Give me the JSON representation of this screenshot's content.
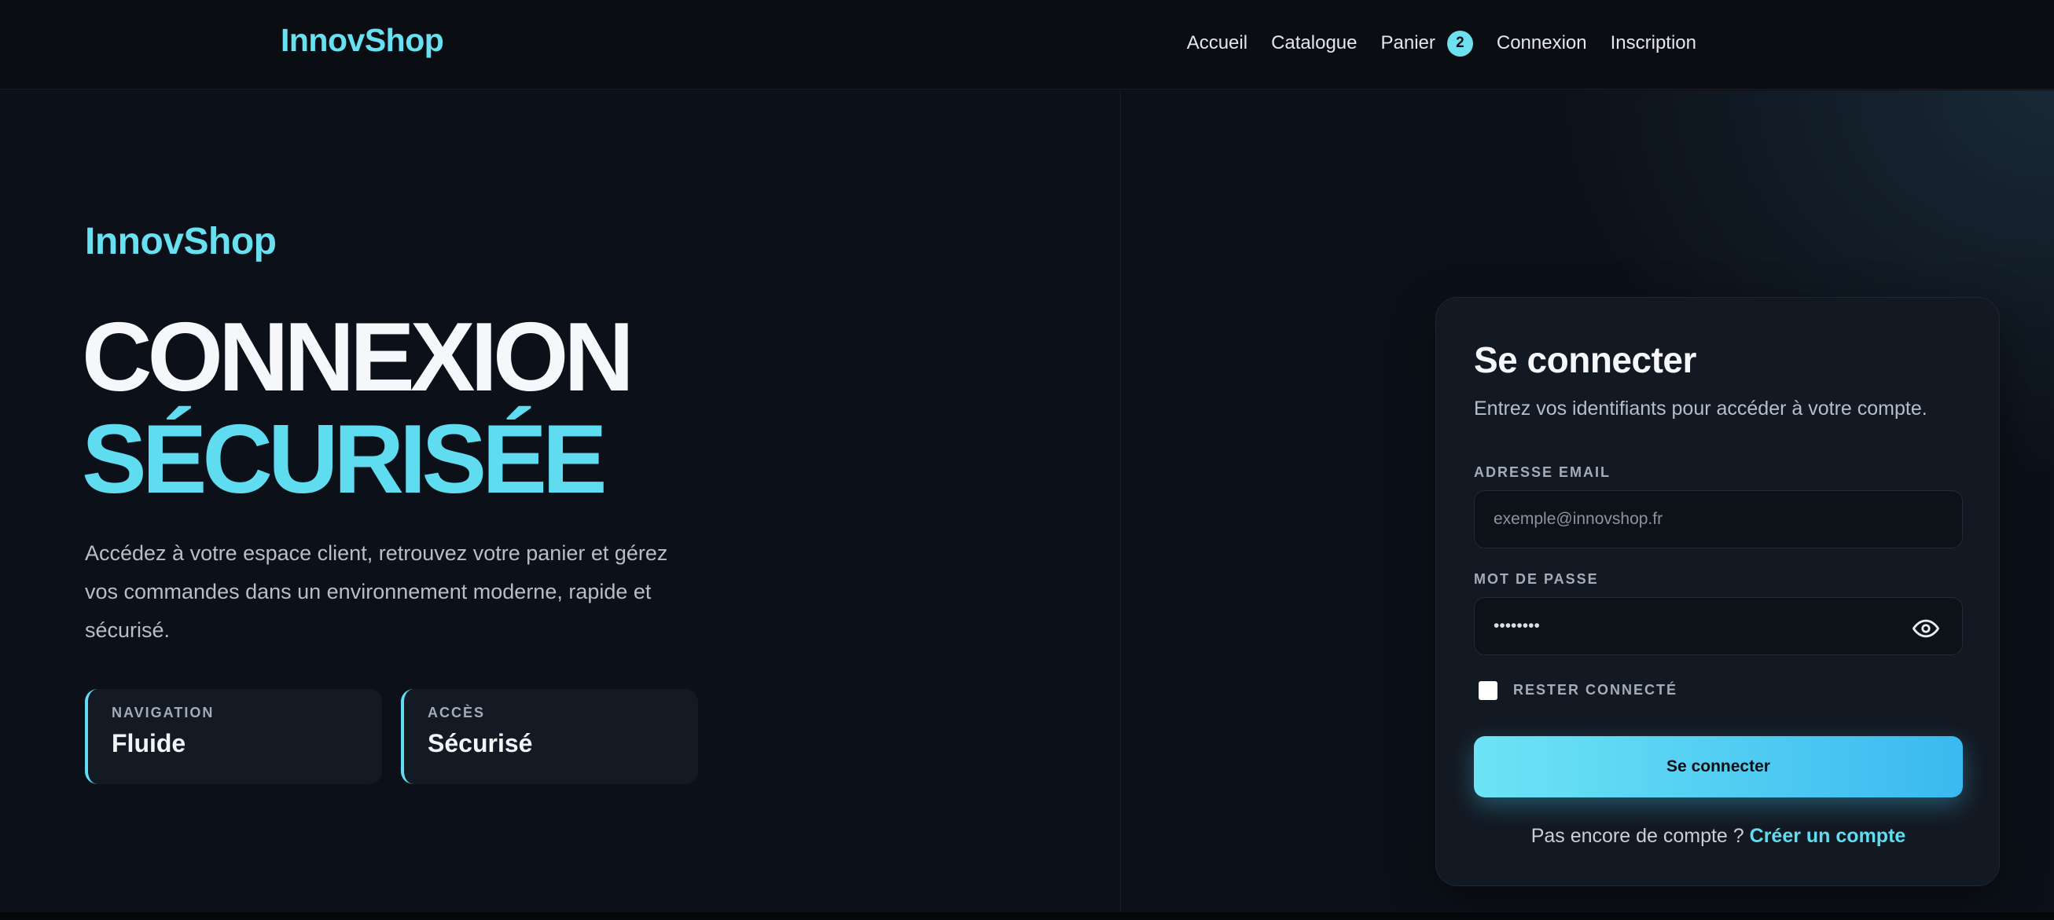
{
  "header": {
    "brand": "InnovShop",
    "nav": {
      "home": "Accueil",
      "catalog": "Catalogue",
      "cart": "Panier",
      "cart_count": "2",
      "login": "Connexion",
      "register": "Inscription"
    }
  },
  "hero": {
    "brand": "InnovShop",
    "title_line1": "CONNEXION",
    "title_line2": "SÉCURISÉE",
    "description": "Accédez à votre espace client, retrouvez votre panier et gérez vos commandes dans un environnement moderne, rapide et sécurisé.",
    "features": [
      {
        "label": "NAVIGATION",
        "value": "Fluide"
      },
      {
        "label": "ACCÈS",
        "value": "Sécurisé"
      }
    ]
  },
  "login": {
    "title": "Se connecter",
    "subtitle": "Entrez vos identifiants pour accéder à votre compte.",
    "email_label": "ADRESSE EMAIL",
    "email_placeholder": "exemple@innovshop.fr",
    "password_label": "MOT DE PASSE",
    "password_value": "••••••••",
    "remember_label": "RESTER CONNECTÉ",
    "submit_label": "Se connecter",
    "signup_prompt": "Pas encore de compte ?",
    "signup_link": "Créer un compte"
  },
  "colors": {
    "accent": "#5fdcf0",
    "background": "#0c1119",
    "card": "#131922",
    "button_gradient_start": "#6de4f5",
    "button_gradient_end": "#3ab9f0"
  },
  "icons": {
    "password_toggle": "eye-icon"
  }
}
